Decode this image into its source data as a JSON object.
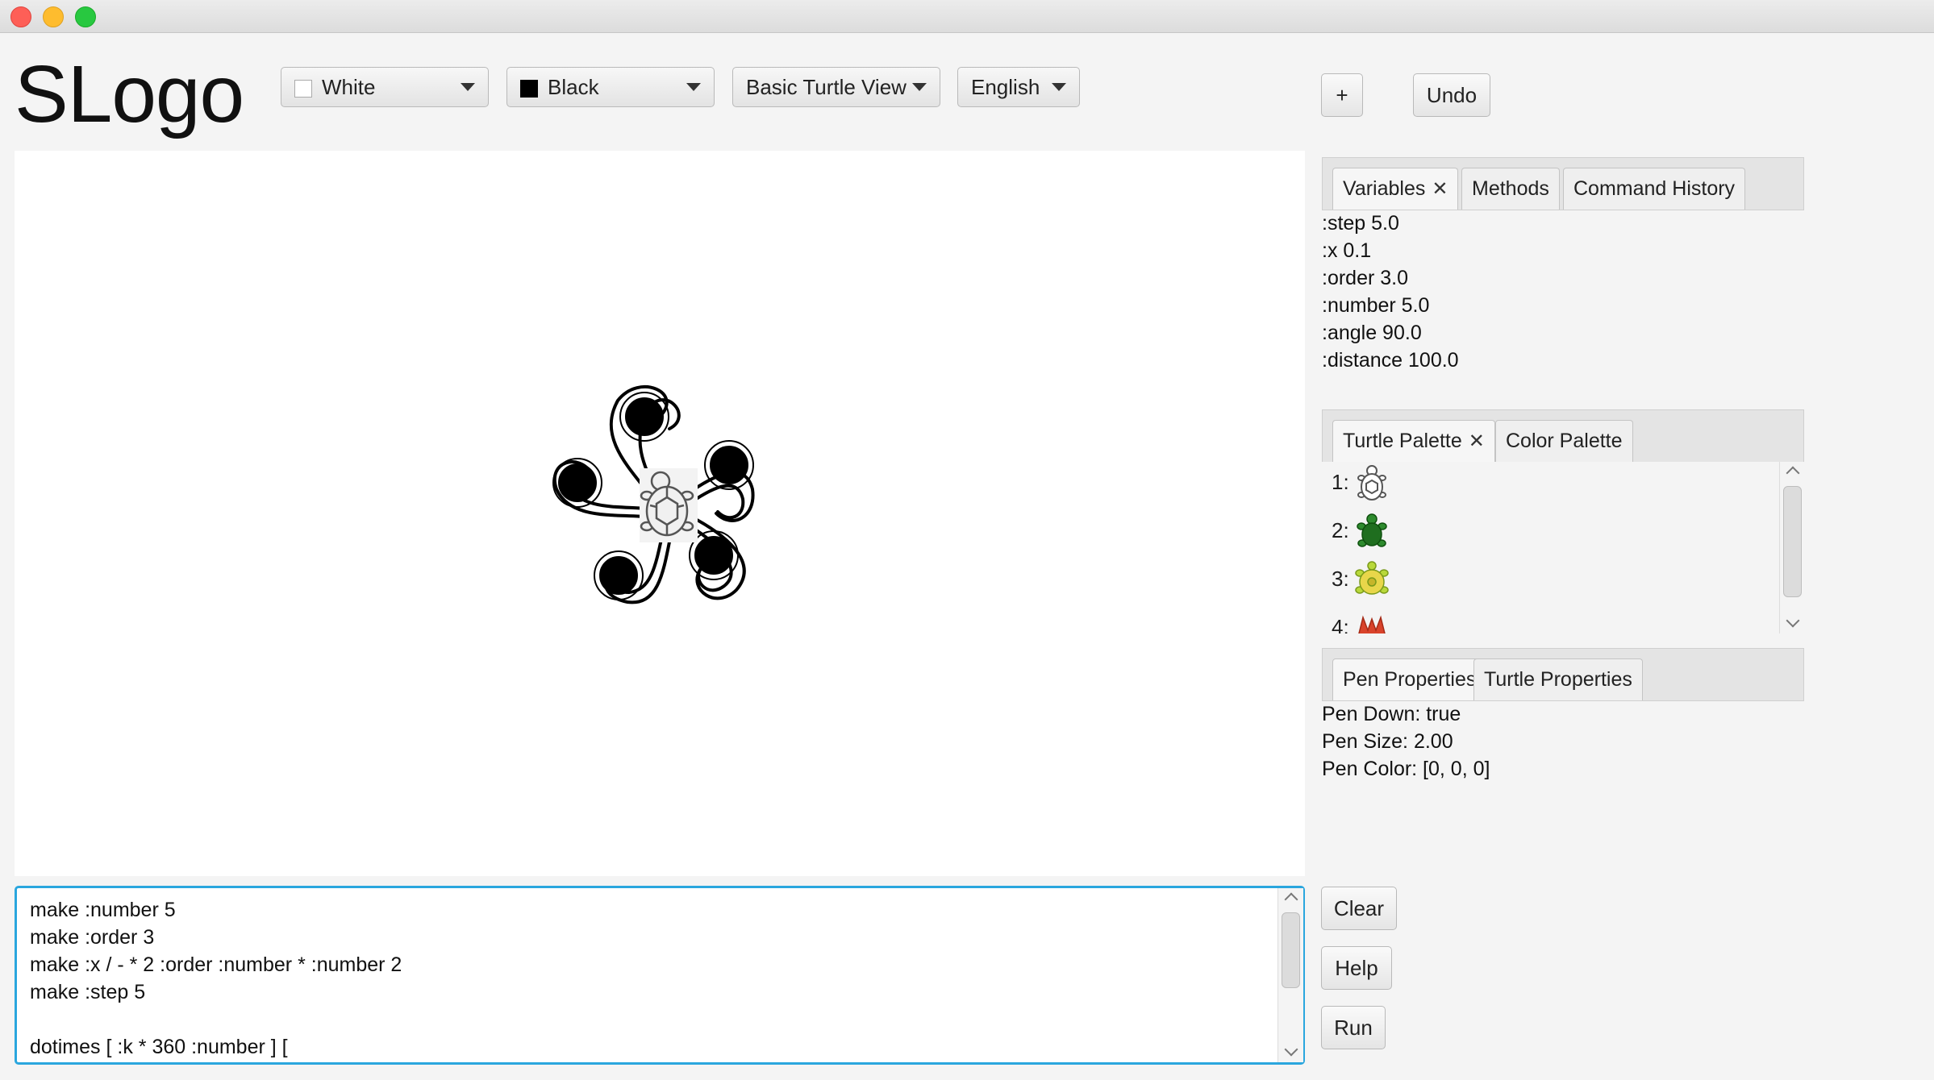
{
  "app": {
    "title": "SLogo"
  },
  "toolbar": {
    "background_color": "White",
    "pen_color": "Black",
    "view": "Basic Turtle View",
    "language": "English",
    "add_label": "+",
    "undo_label": "Undo"
  },
  "variables_pane": {
    "tabs": [
      "Variables",
      "Methods",
      "Command History"
    ],
    "close_glyph": "✕",
    "items": [
      ":step 5.0",
      ":x 0.1",
      ":order 3.0",
      ":number 5.0",
      ":angle 90.0",
      ":distance 100.0"
    ]
  },
  "palette_pane": {
    "tabs": [
      "Turtle Palette",
      "Color Palette"
    ],
    "items": [
      {
        "label": "1:",
        "icon": "turtle-outline-icon"
      },
      {
        "label": "2:",
        "icon": "turtle-green-icon"
      },
      {
        "label": "3:",
        "icon": "turtle-yellow-icon"
      },
      {
        "label": "4:",
        "icon": "red-shape-icon"
      }
    ]
  },
  "properties_pane": {
    "tabs": [
      "Pen Properties",
      "Turtle Properties"
    ],
    "items": [
      "Pen Down: true",
      "Pen Size: 2.00",
      "Pen Color: [0, 0, 0]"
    ]
  },
  "console": {
    "lines": [
      "make :number 5",
      "make :order 3",
      "make :x / - * 2 :order :number * :number 2",
      "make :step 5",
      "",
      "dotimes [ :k * 360 :number ] ["
    ]
  },
  "actions": {
    "clear_label": "Clear",
    "help_label": "Help",
    "run_label": "Run"
  },
  "colors": {
    "accent": "#2aa6de",
    "canvas_background": "#ffffff",
    "pen": "#000000"
  }
}
